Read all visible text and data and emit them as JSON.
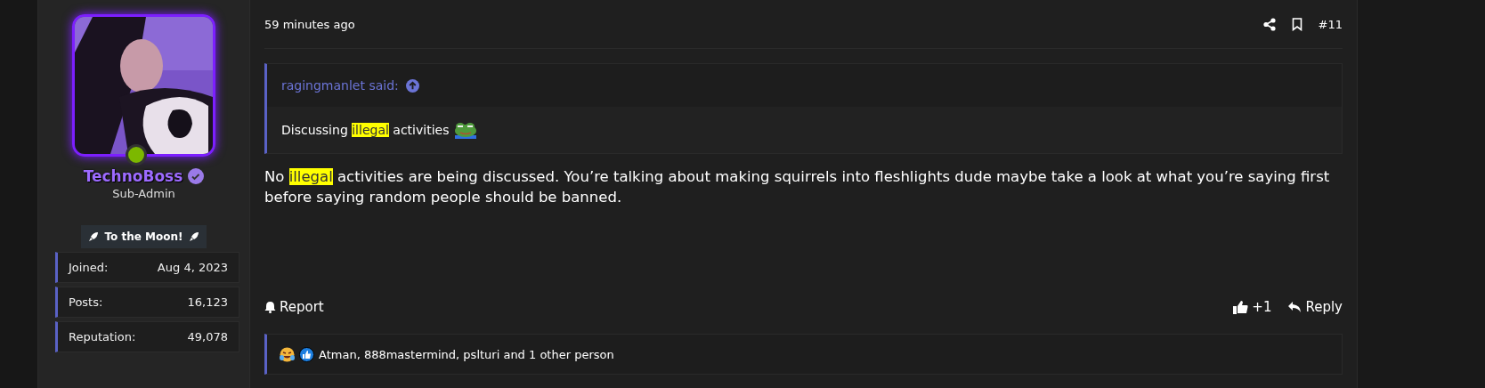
{
  "user": {
    "name": "TechnoBoss",
    "verified": true,
    "online": true,
    "role": "Sub-Admin",
    "banner": "To the Moon!",
    "stats": [
      {
        "label": "Joined:",
        "value": "Aug 4, 2023"
      },
      {
        "label": "Posts:",
        "value": "16,123"
      },
      {
        "label": "Reputation:",
        "value": "49,078"
      }
    ]
  },
  "post": {
    "time": "59 minutes ago",
    "number": "#11",
    "quote": {
      "author": "ragingmanlet said:",
      "segments": [
        {
          "text": "Discussing ",
          "highlighted": false
        },
        {
          "text": "illegal",
          "highlighted": true
        },
        {
          "text": " activities",
          "highlighted": false
        }
      ]
    },
    "body": [
      {
        "text": "No ",
        "highlighted": false
      },
      {
        "text": "illegal",
        "highlighted": true
      },
      {
        "text": " activities are being discussed. You’re talking about making squirrels into fleshlights dude maybe take a look at what you’re saying first before saying random people should be banned.",
        "highlighted": false
      }
    ],
    "report": "Report",
    "like_count": "+1",
    "reply": "Reply",
    "reactions": "Atman, 888mastermind, pslturi and 1 other person"
  }
}
